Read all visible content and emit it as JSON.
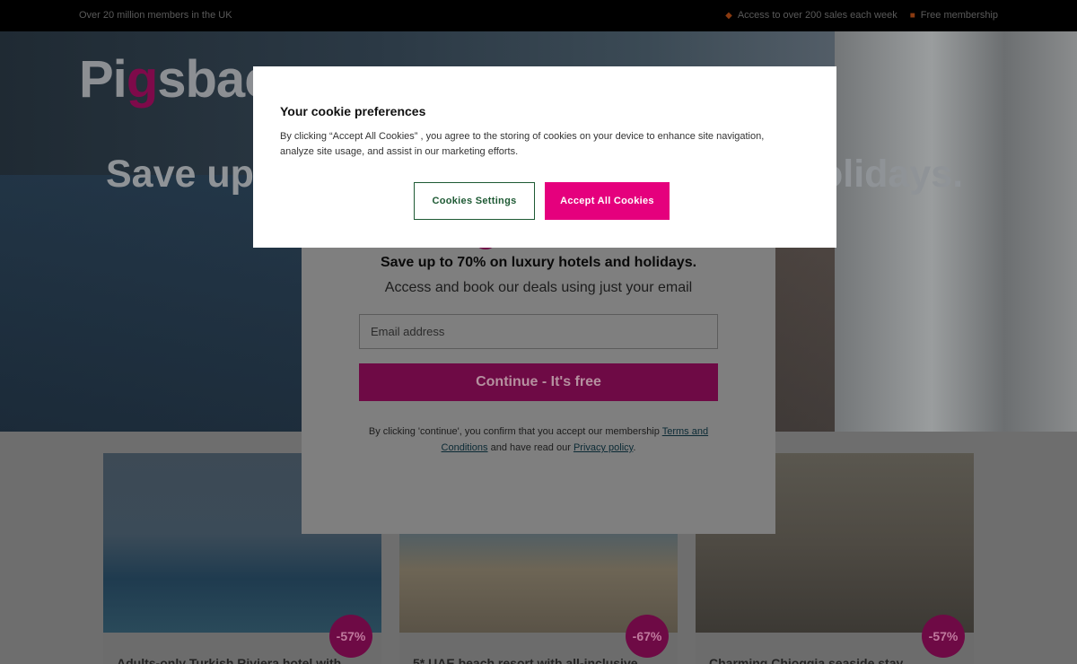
{
  "topbar": {
    "left_text": "Over 20 million members in the UK",
    "items": [
      {
        "label": "Access to over 200 sales each week",
        "icon": "tag-icon"
      },
      {
        "label": "Free membership",
        "icon": "lock-icon"
      }
    ]
  },
  "hero": {
    "logo_pre": "Pi",
    "logo_g": "g",
    "logo_post": "sbac",
    "title_left": "Save up",
    "title_right": "olidays."
  },
  "signup": {
    "title": "Save up to 70% on luxury hotels and holidays.",
    "subtitle": "Access and book our deals using just your email",
    "email_placeholder": "Email address",
    "continue_label": "Continue - It's free",
    "legal_prefix": "By clicking 'continue', you confirm that you accept our membership ",
    "terms_link": "Terms and Conditions",
    "legal_middle": " and have read our ",
    "privacy_link": "Privacy policy",
    "legal_suffix": "."
  },
  "cookie": {
    "title": "Your cookie preferences",
    "body": "By clicking  “Accept All Cookies” , you agree to the storing of cookies on your device to enhance site navigation, analyze site usage, and assist in our marketing efforts.",
    "settings_label": "Cookies Settings",
    "accept_label": "Accept All Cookies"
  },
  "cards": [
    {
      "badge": "-57%",
      "title": "Adults-only Turkish Riviera hotel with"
    },
    {
      "badge": "-67%",
      "title": "5* UAE beach resort with all-inclusive"
    },
    {
      "badge": "-57%",
      "title": "Charming Chioggia seaside stay"
    }
  ],
  "colors": {
    "brand": "#e5007d",
    "settings_border": "#1e5a34"
  }
}
